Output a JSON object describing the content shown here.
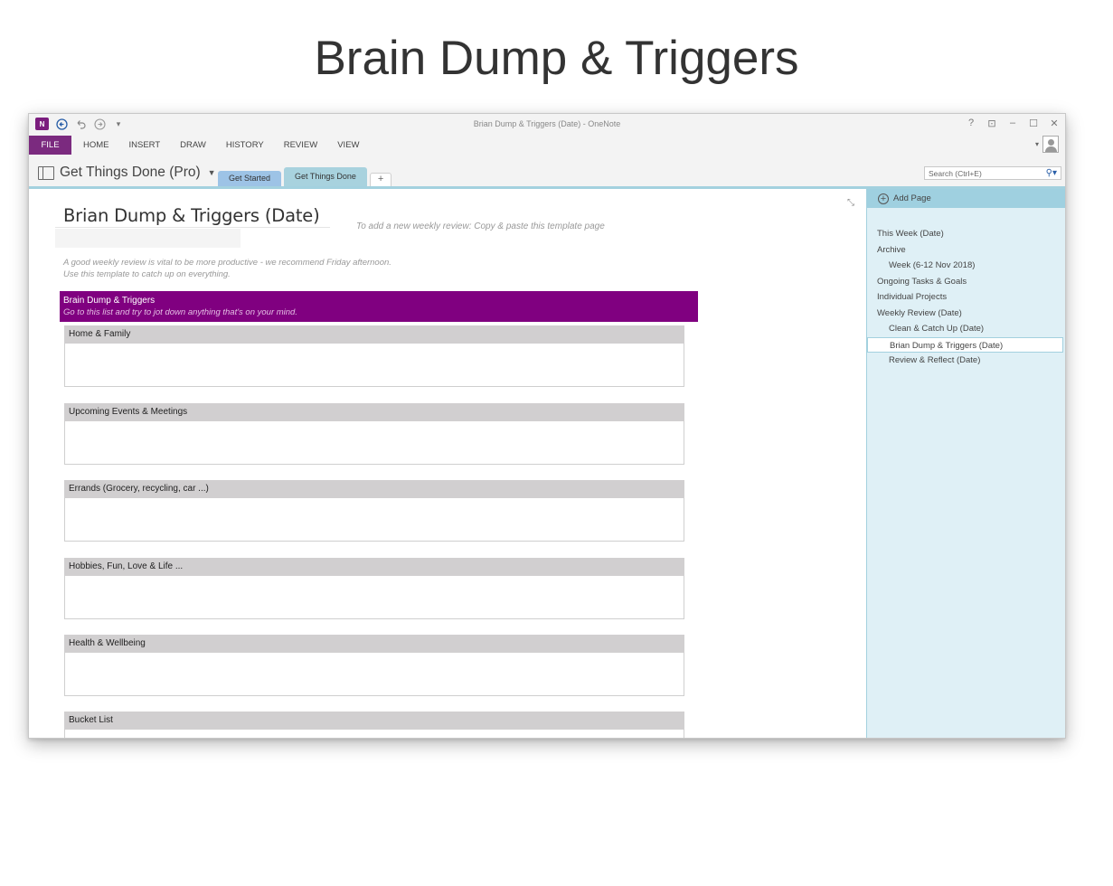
{
  "headline": "Brain Dump & Triggers",
  "window_title": "Brian Dump & Triggers (Date) - OneNote",
  "app_logo_text": "N",
  "ribbon_tabs": [
    "FILE",
    "HOME",
    "INSERT",
    "DRAW",
    "HISTORY",
    "REVIEW",
    "VIEW"
  ],
  "window_controls": [
    "?",
    "⊡",
    "–",
    "☐",
    "✕"
  ],
  "notebook": {
    "name": "Get Things Done (Pro)"
  },
  "sections": [
    {
      "label": "Get Started"
    },
    {
      "label": "Get Things Done"
    }
  ],
  "add_section_label": "+",
  "search": {
    "placeholder": "Search (Ctrl+E)"
  },
  "page": {
    "title": "Brian Dump & Triggers (Date)",
    "hint": "To add a new weekly review: Copy & paste this template page",
    "intro_line1": "A good weekly review is vital to be more productive - we recommend Friday afternoon.",
    "intro_line2": "Use this template to catch up on everything.",
    "banner_title": "Brain Dump & Triggers",
    "banner_subtitle": "Go to this list and try to jot down anything that's on your mind.",
    "lists": [
      "Home & Family",
      "Upcoming Events & Meetings",
      "Errands (Grocery, recycling, car ...)",
      "Hobbies, Fun, Love & Life ...",
      "Health & Wellbeing",
      "Bucket List"
    ]
  },
  "sidebar": {
    "add_page_label": "Add Page",
    "pages": [
      {
        "label": "This Week (Date)",
        "level": 1,
        "selected": false
      },
      {
        "label": "Archive",
        "level": 1,
        "selected": false
      },
      {
        "label": "Week (6-12 Nov 2018)",
        "level": 2,
        "selected": false
      },
      {
        "label": "Ongoing Tasks & Goals",
        "level": 1,
        "selected": false
      },
      {
        "label": "Individual Projects",
        "level": 1,
        "selected": false
      },
      {
        "label": "Weekly Review (Date)",
        "level": 1,
        "selected": false
      },
      {
        "label": "Clean & Catch Up (Date)",
        "level": 2,
        "selected": false
      },
      {
        "label": "Brian Dump & Triggers (Date)",
        "level": 2,
        "selected": true
      },
      {
        "label": "Review & Reflect (Date)",
        "level": 2,
        "selected": false
      }
    ]
  },
  "colors": {
    "file_tab": "#7b2a7f",
    "banner": "#800080",
    "section_accent": "#a3d1df",
    "sidebar_bg": "#dff0f6"
  }
}
